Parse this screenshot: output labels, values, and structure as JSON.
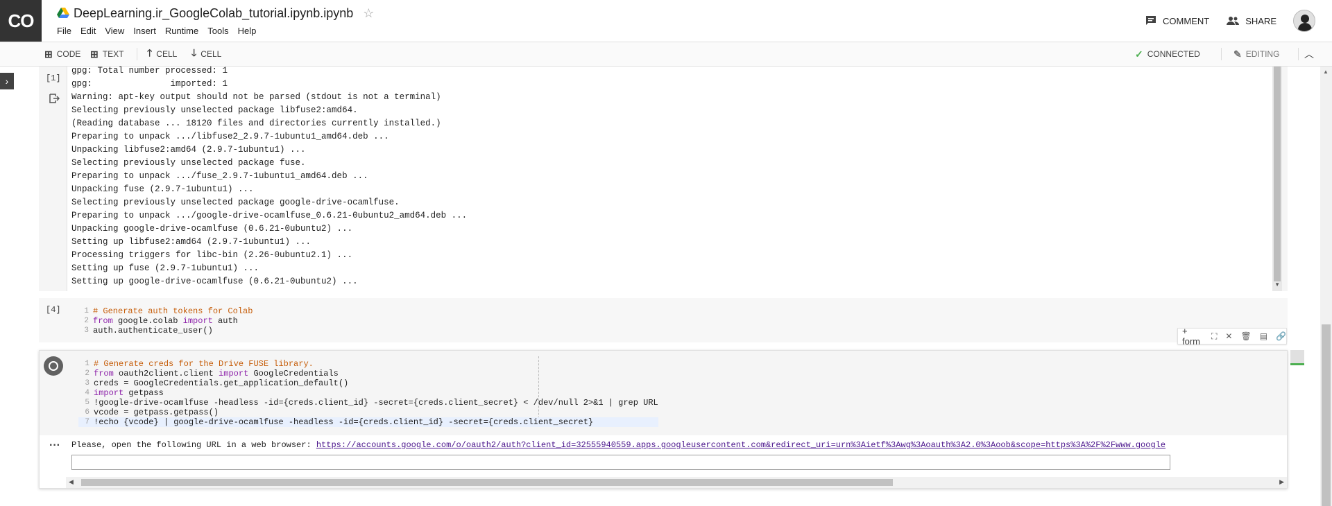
{
  "header": {
    "logo_text": "CO",
    "title": "DeepLearning.ir_GoogleColab_tutorial.ipynb.ipynb",
    "menu": [
      "File",
      "Edit",
      "View",
      "Insert",
      "Runtime",
      "Tools",
      "Help"
    ],
    "comment_label": "COMMENT",
    "share_label": "SHARE"
  },
  "toolbar": {
    "code_label": "CODE",
    "text_label": "TEXT",
    "cell_up_label": "CELL",
    "cell_down_label": "CELL",
    "connected_label": "CONNECTED",
    "editing_label": "EDITING"
  },
  "colors": {
    "connected": "#4caf50",
    "comment_color": "#c65d09",
    "keyword_color": "#8e24aa",
    "link_color": "#4a148c"
  },
  "cell1": {
    "exec_count": "[1]",
    "output_lines": [
      "gpg: Total number processed: 1",
      "gpg:               imported: 1",
      "Warning: apt-key output should not be parsed (stdout is not a terminal)",
      "Selecting previously unselected package libfuse2:amd64.",
      "(Reading database ... 18120 files and directories currently installed.)",
      "Preparing to unpack .../libfuse2_2.9.7-1ubuntu1_amd64.deb ...",
      "Unpacking libfuse2:amd64 (2.9.7-1ubuntu1) ...",
      "Selecting previously unselected package fuse.",
      "Preparing to unpack .../fuse_2.9.7-1ubuntu1_amd64.deb ...",
      "Unpacking fuse (2.9.7-1ubuntu1) ...",
      "Selecting previously unselected package google-drive-ocamlfuse.",
      "Preparing to unpack .../google-drive-ocamlfuse_0.6.21-0ubuntu2_amd64.deb ...",
      "Unpacking google-drive-ocamlfuse (0.6.21-0ubuntu2) ...",
      "Setting up libfuse2:amd64 (2.9.7-1ubuntu1) ...",
      "Processing triggers for libc-bin (2.26-0ubuntu2.1) ...",
      "Setting up fuse (2.9.7-1ubuntu1) ...",
      "Setting up google-drive-ocamlfuse (0.6.21-0ubuntu2) ..."
    ]
  },
  "cell4": {
    "exec_count": "[4]",
    "lines": [
      {
        "n": "1",
        "comment": "# Generate auth tokens for Colab"
      },
      {
        "n": "2",
        "kw1": "from",
        "mid": " google.colab ",
        "kw2": "import",
        "rest": " auth"
      },
      {
        "n": "3",
        "rest": "auth.authenticate_user()"
      }
    ]
  },
  "cell_tools": {
    "form_label": "+ form"
  },
  "cell5": {
    "lines": [
      {
        "n": "1",
        "comment": "# Generate creds for the Drive FUSE library."
      },
      {
        "n": "2",
        "kw1": "from",
        "mid": " oauth2client.client ",
        "kw2": "import",
        "rest": " GoogleCredentials"
      },
      {
        "n": "3",
        "rest": "creds = GoogleCredentials.get_application_default()"
      },
      {
        "n": "4",
        "kw1": "import",
        "rest": " getpass"
      },
      {
        "n": "5",
        "rest": "!google-drive-ocamlfuse -headless -id={creds.client_id} -secret={creds.client_secret} < /dev/null 2>&1 | grep URL"
      },
      {
        "n": "6",
        "rest": "vcode = getpass.getpass()"
      },
      {
        "n": "7",
        "rest": "!echo {vcode} | google-drive-ocamlfuse -headless -id={creds.client_id} -secret={creds.client_secret}"
      }
    ],
    "output_prefix": "Please, open the following URL in a web browser: ",
    "output_url": "https://accounts.google.com/o/oauth2/auth?client_id=32555940559.apps.googleusercontent.com&redirect_uri=urn%3Aietf%3Awg%3Aoauth%3A2.0%3Aoob&scope=https%3A%2F%2Fwww.google"
  }
}
